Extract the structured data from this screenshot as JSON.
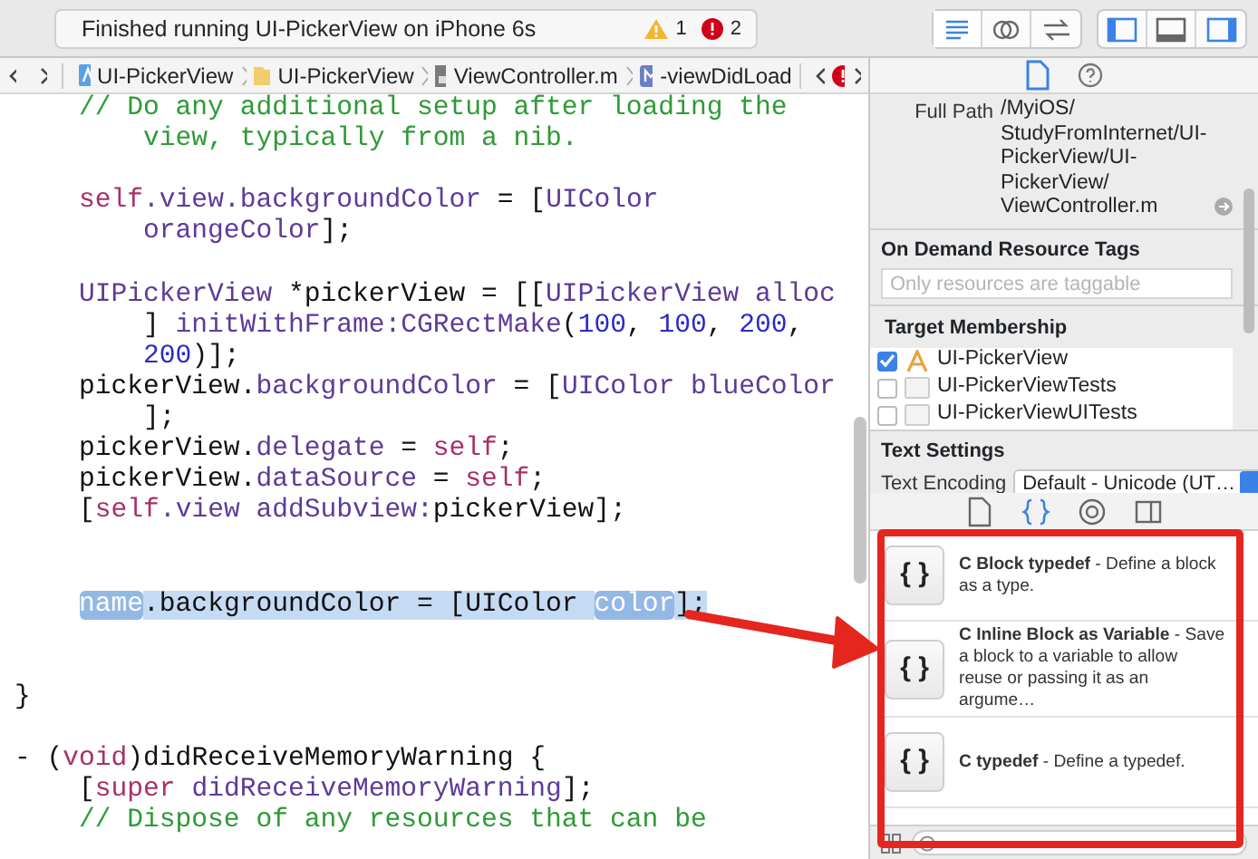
{
  "toolbar": {
    "status": "Finished running UI-PickerView on iPhone 6s",
    "warnings": "1",
    "errors": "2",
    "editor_modes": [
      {
        "kind": "standard",
        "selected": true
      },
      {
        "kind": "assistant",
        "selected": false
      },
      {
        "kind": "version",
        "selected": false
      }
    ],
    "panels": [
      {
        "kind": "navigator",
        "on": true
      },
      {
        "kind": "debug",
        "on": false
      },
      {
        "kind": "utilities",
        "on": true
      }
    ]
  },
  "jump_bar": {
    "items": [
      {
        "kind": "project",
        "label": "UI-PickerView"
      },
      {
        "kind": "folder",
        "label": "UI-PickerView"
      },
      {
        "kind": "file",
        "label": "ViewController.m"
      },
      {
        "kind": "method",
        "label": "-viewDidLoad"
      }
    ]
  },
  "editor": {
    "lines": [
      {
        "kind": "code",
        "tokens": [
          {
            "kind": "comment",
            "text": "    // Do any additional setup after loading the"
          }
        ]
      },
      {
        "kind": "code",
        "tokens": [
          {
            "kind": "comment",
            "text": "        view, typically from a nib."
          }
        ]
      },
      {
        "kind": "blank"
      },
      {
        "kind": "code",
        "tokens": [
          {
            "kind": "keyword",
            "text": "    self"
          },
          {
            "kind": "member",
            "text": ".view.backgroundColor"
          },
          {
            "kind": "plain",
            "text": " = ["
          },
          {
            "kind": "member",
            "text": "UIColor"
          }
        ]
      },
      {
        "kind": "code",
        "tokens": [
          {
            "kind": "member",
            "text": "        orangeColor"
          },
          {
            "kind": "plain",
            "text": "];"
          }
        ]
      },
      {
        "kind": "blank"
      },
      {
        "kind": "code",
        "tokens": [
          {
            "kind": "member",
            "text": "    UIPickerView"
          },
          {
            "kind": "plain",
            "text": " *pickerView = [["
          },
          {
            "kind": "member",
            "text": "UIPickerView alloc"
          }
        ]
      },
      {
        "kind": "code",
        "tokens": [
          {
            "kind": "plain",
            "text": "        ] "
          },
          {
            "kind": "member",
            "text": "initWithFrame:CGRectMake"
          },
          {
            "kind": "plain",
            "text": "("
          },
          {
            "kind": "number",
            "text": "100"
          },
          {
            "kind": "plain",
            "text": ", "
          },
          {
            "kind": "number",
            "text": "100"
          },
          {
            "kind": "plain",
            "text": ", "
          },
          {
            "kind": "number",
            "text": "200"
          },
          {
            "kind": "plain",
            "text": ","
          }
        ]
      },
      {
        "kind": "code",
        "tokens": [
          {
            "kind": "number",
            "text": "        200"
          },
          {
            "kind": "plain",
            "text": ")];"
          }
        ]
      },
      {
        "kind": "code",
        "tokens": [
          {
            "kind": "plain",
            "text": "    pickerView."
          },
          {
            "kind": "member",
            "text": "backgroundColor"
          },
          {
            "kind": "plain",
            "text": " = ["
          },
          {
            "kind": "member",
            "text": "UIColor blueColor"
          }
        ]
      },
      {
        "kind": "code",
        "tokens": [
          {
            "kind": "plain",
            "text": "        ];"
          }
        ]
      },
      {
        "kind": "code",
        "tokens": [
          {
            "kind": "plain",
            "text": "    pickerView."
          },
          {
            "kind": "member",
            "text": "delegate"
          },
          {
            "kind": "plain",
            "text": " = "
          },
          {
            "kind": "keyword",
            "text": "self"
          },
          {
            "kind": "plain",
            "text": ";"
          }
        ]
      },
      {
        "kind": "code",
        "tokens": [
          {
            "kind": "plain",
            "text": "    pickerView."
          },
          {
            "kind": "member",
            "text": "dataSource"
          },
          {
            "kind": "plain",
            "text": " = "
          },
          {
            "kind": "keyword",
            "text": "self"
          },
          {
            "kind": "plain",
            "text": ";"
          }
        ]
      },
      {
        "kind": "code",
        "tokens": [
          {
            "kind": "plain",
            "text": "    ["
          },
          {
            "kind": "keyword",
            "text": "self"
          },
          {
            "kind": "member",
            "text": ".view addSubview:"
          },
          {
            "kind": "plain",
            "text": "pickerView];"
          }
        ]
      },
      {
        "kind": "blank"
      },
      {
        "kind": "blank"
      },
      {
        "kind": "code",
        "highlighted": true,
        "tokens": [
          {
            "kind": "placeholder",
            "text": "name"
          },
          {
            "kind": "plain",
            "text": ".backgroundColor = [UIColor "
          },
          {
            "kind": "placeholder",
            "text": "color"
          },
          {
            "kind": "plain",
            "text": "];"
          }
        ]
      },
      {
        "kind": "blank"
      },
      {
        "kind": "blank"
      },
      {
        "kind": "code",
        "tokens": [
          {
            "kind": "plain",
            "text": "}"
          }
        ]
      },
      {
        "kind": "blank"
      },
      {
        "kind": "code",
        "tokens": [
          {
            "kind": "plain",
            "text": "- ("
          },
          {
            "kind": "keyword",
            "text": "void"
          },
          {
            "kind": "plain",
            "text": ")didReceiveMemoryWarning {"
          }
        ]
      },
      {
        "kind": "code",
        "tokens": [
          {
            "kind": "plain",
            "text": "    ["
          },
          {
            "kind": "keyword",
            "text": "super"
          },
          {
            "kind": "member",
            "text": " didReceiveMemoryWarning"
          },
          {
            "kind": "plain",
            "text": "];"
          }
        ]
      },
      {
        "kind": "code",
        "tokens": [
          {
            "kind": "comment",
            "text": "    // Dispose of any resources that can be"
          }
        ]
      }
    ]
  },
  "inspector": {
    "tabs": [
      {
        "kind": "file",
        "selected": true
      },
      {
        "kind": "help",
        "selected": false
      }
    ],
    "full_path": {
      "label": "Full Path",
      "lines": [
        "/MyiOS/",
        "StudyFromInternet/UI-",
        "PickerView/UI-",
        "PickerView/",
        "ViewController.m"
      ]
    },
    "resource_tags": {
      "title": "On Demand Resource Tags",
      "placeholder": "Only resources are taggable"
    },
    "target_membership": {
      "title": "Target Membership",
      "targets": [
        {
          "kind": "app",
          "label": "UI-PickerView",
          "checked": true
        },
        {
          "kind": "bundle",
          "label": "UI-PickerViewTests",
          "checked": false
        },
        {
          "kind": "bundle",
          "label": "UI-PickerViewUITests",
          "checked": false
        }
      ]
    },
    "text_settings": {
      "title": "Text Settings",
      "encoding_label": "Text Encoding",
      "encoding_value": "Default - Unicode (UT…"
    }
  },
  "library": {
    "tabs": [
      {
        "kind": "file",
        "selected": false
      },
      {
        "kind": "snippet",
        "selected": true
      },
      {
        "kind": "object",
        "selected": false
      },
      {
        "kind": "media",
        "selected": false
      }
    ],
    "snippets": [
      {
        "icon_text": "{ }",
        "text": "**C Block typedef** - Define a block as a type."
      },
      {
        "icon_text": "{ }",
        "text": "**C Inline Block as Variable** - Save a block to a variable to allow reuse or passing it as an argume…"
      },
      {
        "icon_text": "{ }",
        "text": "**C typedef** - Define a typedef."
      }
    ]
  }
}
